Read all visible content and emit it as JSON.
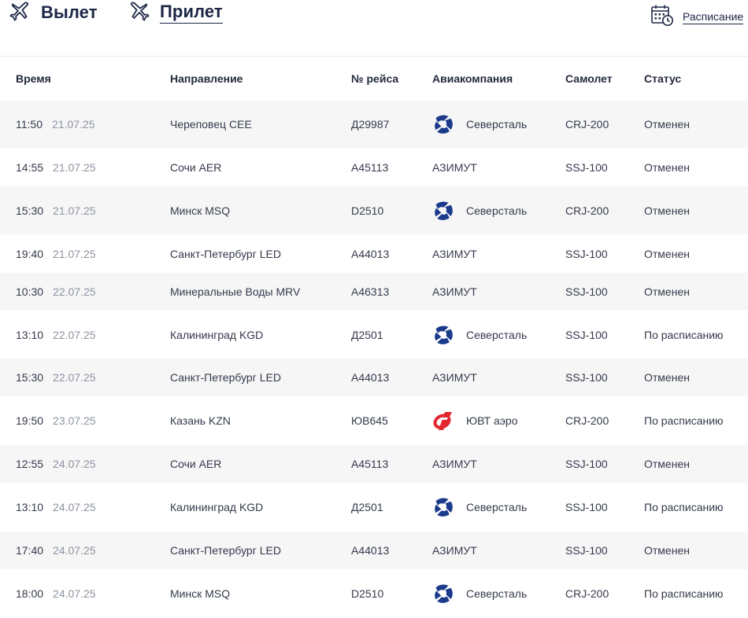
{
  "tabs": [
    {
      "label": "Вылет",
      "icon": "plane-departure-icon"
    },
    {
      "label": "Прилет",
      "icon": "plane-arrival-icon",
      "active": true
    }
  ],
  "schedule_link": {
    "label": "Расписание",
    "icon": "calendar-clock-icon"
  },
  "columns": [
    "Время",
    "Направление",
    "№ рейса",
    "Авиакомпания",
    "Самолет",
    "Статус"
  ],
  "colors": {
    "brand_dark": "#1c2645",
    "severstal_blue": "#1b3a8c",
    "yuvt_red": "#e3262f",
    "row_stripe": "#f6f6f7"
  },
  "flights": [
    {
      "time": "11:50",
      "date": "21.07.25",
      "destination": "Череповец CEE",
      "flight": "Д29987",
      "airline": "Северсталь",
      "logo": "severstal",
      "aircraft": "CRJ-200",
      "status": "Отменен"
    },
    {
      "time": "14:55",
      "date": "21.07.25",
      "destination": "Сочи AER",
      "flight": "А45113",
      "airline": "АЗИМУТ",
      "logo": "",
      "aircraft": "SSJ-100",
      "status": "Отменен"
    },
    {
      "time": "15:30",
      "date": "21.07.25",
      "destination": "Минск MSQ",
      "flight": "D2510",
      "airline": "Северсталь",
      "logo": "severstal",
      "aircraft": "CRJ-200",
      "status": "Отменен"
    },
    {
      "time": "19:40",
      "date": "21.07.25",
      "destination": "Санкт-Петербург LED",
      "flight": "А44013",
      "airline": "АЗИМУТ",
      "logo": "",
      "aircraft": "SSJ-100",
      "status": "Отменен"
    },
    {
      "time": "10:30",
      "date": "22.07.25",
      "destination": "Минеральные Воды MRV",
      "flight": "А46313",
      "airline": "АЗИМУТ",
      "logo": "",
      "aircraft": "SSJ-100",
      "status": "Отменен"
    },
    {
      "time": "13:10",
      "date": "22.07.25",
      "destination": "Калининград KGD",
      "flight": "Д2501",
      "airline": "Северсталь",
      "logo": "severstal",
      "aircraft": "SSJ-100",
      "status": "По расписанию"
    },
    {
      "time": "15:30",
      "date": "22.07.25",
      "destination": "Санкт-Петербург LED",
      "flight": "А44013",
      "airline": "АЗИМУТ",
      "logo": "",
      "aircraft": "SSJ-100",
      "status": "Отменен"
    },
    {
      "time": "19:50",
      "date": "23.07.25",
      "destination": "Казань KZN",
      "flight": "ЮВ645",
      "airline": "ЮВТ аэро",
      "logo": "yuvt",
      "aircraft": "CRJ-200",
      "status": "По расписанию"
    },
    {
      "time": "12:55",
      "date": "24.07.25",
      "destination": "Сочи AER",
      "flight": "А45113",
      "airline": "АЗИМУТ",
      "logo": "",
      "aircraft": "SSJ-100",
      "status": "Отменен"
    },
    {
      "time": "13:10",
      "date": "24.07.25",
      "destination": "Калининград KGD",
      "flight": "Д2501",
      "airline": "Северсталь",
      "logo": "severstal",
      "aircraft": "SSJ-100",
      "status": "По расписанию"
    },
    {
      "time": "17:40",
      "date": "24.07.25",
      "destination": "Санкт-Петербург LED",
      "flight": "А44013",
      "airline": "АЗИМУТ",
      "logo": "",
      "aircraft": "SSJ-100",
      "status": "Отменен"
    },
    {
      "time": "18:00",
      "date": "24.07.25",
      "destination": "Минск MSQ",
      "flight": "D2510",
      "airline": "Северсталь",
      "logo": "severstal",
      "aircraft": "CRJ-200",
      "status": "По расписанию"
    }
  ]
}
